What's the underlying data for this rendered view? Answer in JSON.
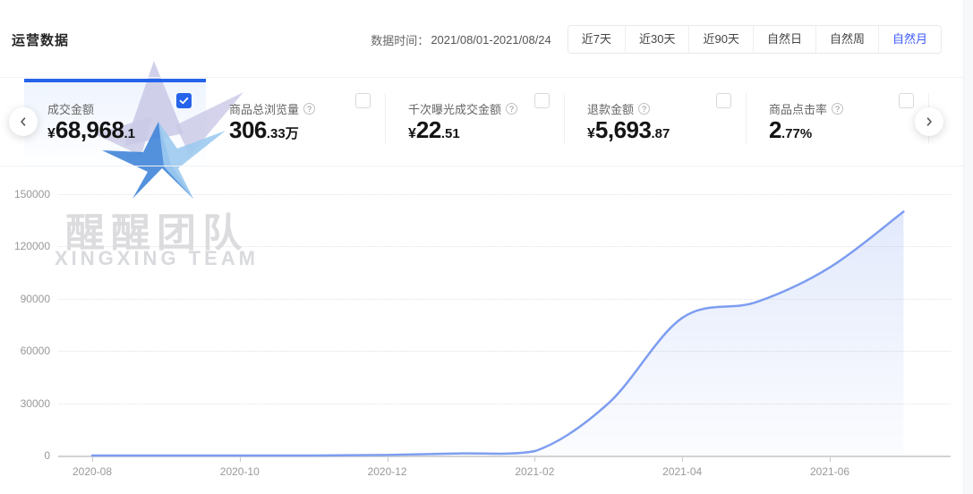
{
  "header": {
    "title": "运营数据",
    "date_label": "数据时间：",
    "date_value": "2021/08/01-2021/08/24",
    "range_buttons": [
      {
        "label": "近7天",
        "active": false
      },
      {
        "label": "近30天",
        "active": false
      },
      {
        "label": "近90天",
        "active": false
      },
      {
        "label": "自然日",
        "active": false
      },
      {
        "label": "自然周",
        "active": false
      },
      {
        "label": "自然月",
        "active": true
      }
    ]
  },
  "cards": [
    {
      "label": "成交金额",
      "has_info": false,
      "value_prefix": "¥",
      "value_main": "68,968",
      "value_suffix": ".1",
      "checked": true,
      "selected": true
    },
    {
      "label": "商品总浏览量",
      "has_info": true,
      "value_prefix": "",
      "value_main": "306",
      "value_suffix": ".33万",
      "checked": false,
      "selected": false
    },
    {
      "label": "千次曝光成交金额",
      "has_info": true,
      "value_prefix": "¥",
      "value_main": "22",
      "value_suffix": ".51",
      "checked": false,
      "selected": false
    },
    {
      "label": "退款金额",
      "has_info": true,
      "value_prefix": "¥",
      "value_main": "5,693",
      "value_suffix": ".87",
      "checked": false,
      "selected": false
    },
    {
      "label": "商品点击率",
      "has_info": true,
      "value_prefix": "",
      "value_main": "2",
      "value_suffix": ".77%",
      "checked": false,
      "selected": false
    }
  ],
  "watermark": {
    "line1": "醒醒团队",
    "line2": "XINGXING TEAM"
  },
  "colors": {
    "accent": "#2563eb",
    "active_range_text": "#3d5afe",
    "series_line": "#7d9df0",
    "axis_label": "#999999",
    "grid": "#e2e2e5",
    "logo_dark_blue": "#3b82d8",
    "logo_light_blue": "#9ccaf0",
    "logo_lavender": "#c9c8e6",
    "watermark_gray": "#dcdcdf"
  },
  "chart_data": {
    "type": "area",
    "series_name": "成交金额",
    "x": [
      "2020-08",
      "2020-09",
      "2020-10",
      "2020-11",
      "2020-12",
      "2021-01",
      "2021-02",
      "2021-03",
      "2021-04",
      "2021-05",
      "2021-06",
      "2021-07"
    ],
    "values": [
      0,
      0,
      0,
      0,
      300,
      1200,
      2500,
      30000,
      79000,
      88000,
      108000,
      140000
    ],
    "x_tick_labels": [
      "2020-08",
      "2020-10",
      "2020-12",
      "2021-02",
      "2021-04",
      "2021-06"
    ],
    "y_ticks": [
      0,
      30000,
      60000,
      90000,
      120000,
      150000
    ],
    "ylim": [
      0,
      150000
    ],
    "grid": "horizontal-dotted",
    "legend": "none",
    "line_color": "#7d9df0",
    "fill": "light-blue vertical gradient under curve"
  }
}
